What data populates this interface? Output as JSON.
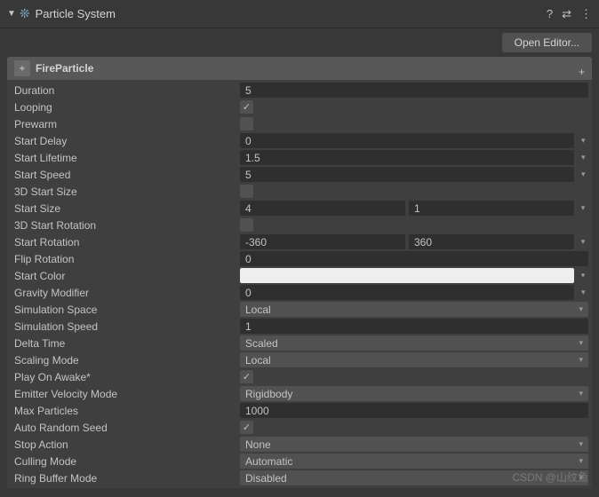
{
  "header": {
    "title": "Particle System"
  },
  "openEditor": "Open Editor...",
  "module": {
    "name": "FireParticle"
  },
  "props": {
    "duration": {
      "label": "Duration",
      "value": "5"
    },
    "looping": {
      "label": "Looping",
      "value": true
    },
    "prewarm": {
      "label": "Prewarm",
      "value": false
    },
    "startDelay": {
      "label": "Start Delay",
      "value": "0"
    },
    "startLifetime": {
      "label": "Start Lifetime",
      "value": "1.5"
    },
    "startSpeed": {
      "label": "Start Speed",
      "value": "5"
    },
    "threeDStartSize": {
      "label": "3D Start Size",
      "value": false
    },
    "startSize": {
      "label": "Start Size",
      "min": "4",
      "max": "1"
    },
    "threeDStartRotation": {
      "label": "3D Start Rotation",
      "value": false
    },
    "startRotation": {
      "label": "Start Rotation",
      "min": "-360",
      "max": "360"
    },
    "flipRotation": {
      "label": "Flip Rotation",
      "value": "0"
    },
    "startColor": {
      "label": "Start Color",
      "value": "#eeeeee"
    },
    "gravityModifier": {
      "label": "Gravity Modifier",
      "value": "0"
    },
    "simulationSpace": {
      "label": "Simulation Space",
      "value": "Local"
    },
    "simulationSpeed": {
      "label": "Simulation Speed",
      "value": "1"
    },
    "deltaTime": {
      "label": "Delta Time",
      "value": "Scaled"
    },
    "scalingMode": {
      "label": "Scaling Mode",
      "value": "Local"
    },
    "playOnAwake": {
      "label": "Play On Awake*",
      "value": true
    },
    "emitterVelocityMode": {
      "label": "Emitter Velocity Mode",
      "value": "Rigidbody"
    },
    "maxParticles": {
      "label": "Max Particles",
      "value": "1000"
    },
    "autoRandomSeed": {
      "label": "Auto Random Seed",
      "value": true
    },
    "stopAction": {
      "label": "Stop Action",
      "value": "None"
    },
    "cullingMode": {
      "label": "Culling Mode",
      "value": "Automatic"
    },
    "ringBufferMode": {
      "label": "Ring Buffer Mode",
      "value": "Disabled"
    }
  },
  "watermark": "CSDN @山纹鱼"
}
